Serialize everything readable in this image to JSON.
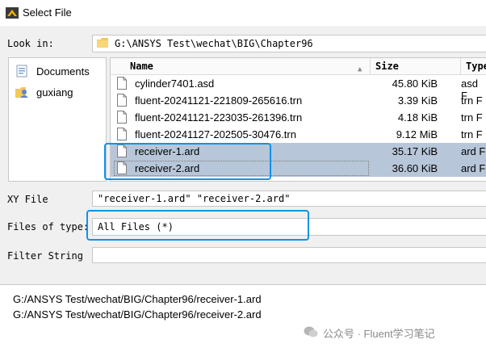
{
  "window": {
    "title": "Select File"
  },
  "look_in": {
    "label": "Look in:",
    "path": "G:\\ANSYS Test\\wechat\\BIG\\Chapter96"
  },
  "sidebar": {
    "items": [
      {
        "label": "Documents",
        "icon": "documents-folder-icon"
      },
      {
        "label": "guxiang",
        "icon": "user-folder-icon"
      }
    ]
  },
  "file_list": {
    "columns": {
      "name": "Name",
      "size": "Size",
      "type": "Type"
    },
    "rows": [
      {
        "name": "cylinder7401.asd",
        "size": "45.80 KiB",
        "type": "asd F",
        "selected": false
      },
      {
        "name": "fluent-20241121-221809-265616.trn",
        "size": "3.39 KiB",
        "type": "trn F",
        "selected": false
      },
      {
        "name": "fluent-20241121-223035-261396.trn",
        "size": "4.18 KiB",
        "type": "trn F",
        "selected": false
      },
      {
        "name": "fluent-20241127-202505-30476.trn",
        "size": "9.12 MiB",
        "type": "trn F",
        "selected": false
      },
      {
        "name": "receiver-1.ard",
        "size": "35.17 KiB",
        "type": "ard F",
        "selected": true
      },
      {
        "name": "receiver-2.ard",
        "size": "36.60 KiB",
        "type": "ard F",
        "selected": true
      }
    ]
  },
  "xy_file": {
    "label": "XY File",
    "value": "\"receiver-1.ard\" \"receiver-2.ard\""
  },
  "files_of_type": {
    "label": "Files of type:",
    "value": "All Files (*)"
  },
  "filter_string": {
    "label": "Filter String",
    "value": ""
  },
  "selection_list": [
    "G:/ANSYS Test/wechat/BIG/Chapter96/receiver-1.ard",
    "G:/ANSYS Test/wechat/BIG/Chapter96/receiver-2.ard"
  ],
  "watermark": "公众号 · Fluent学习笔记",
  "colors": {
    "highlight": "#0f93e8",
    "selection": "#b7c6d9"
  }
}
